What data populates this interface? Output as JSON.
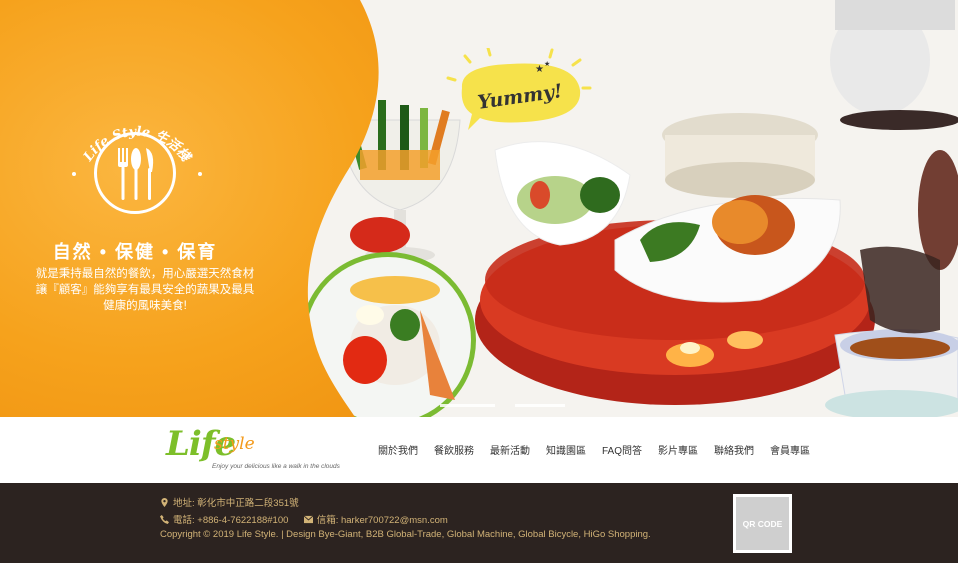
{
  "hero": {
    "brand_arc_text": "Life Style 生活棧",
    "title": "自然 • 保健 • 保育",
    "desc_lines": [
      "就是秉持最自然的餐飲，用心嚴選天然食材",
      "讓『顧客』能夠享有最具安全的蔬果及最具",
      "健康的風味美食!"
    ],
    "yummy": "Yummy!",
    "accent_orange": "#f6a21c"
  },
  "logo": {
    "main": "Life",
    "sub": "style",
    "tagline": "Enjoy your delicious like a walk in the clouds",
    "green": "#7dbf2a",
    "orange": "#f39a1b"
  },
  "nav": {
    "items": [
      "關於我們",
      "餐飲服務",
      "最新活動",
      "知識園區",
      "FAQ問答",
      "影片專區",
      "聯絡我們",
      "會員專區"
    ]
  },
  "footer": {
    "address": "地址: 彰化市中正路二段351號",
    "phone": "電話: +886-4-7622188#100",
    "email": "信箱: harker700722@msn.com",
    "copyright": "Copyright © 2019 Life Style.  | Design Bye-Giant, B2B Global-Trade, Global Machine, Global Bicycle, HiGo Shopping.",
    "qr_label": "QR CODE",
    "bg": "#2c2320",
    "text_color": "#d2b377"
  },
  "icons": [
    "location-pin-icon",
    "phone-icon",
    "mail-icon",
    "utensils-icon"
  ]
}
